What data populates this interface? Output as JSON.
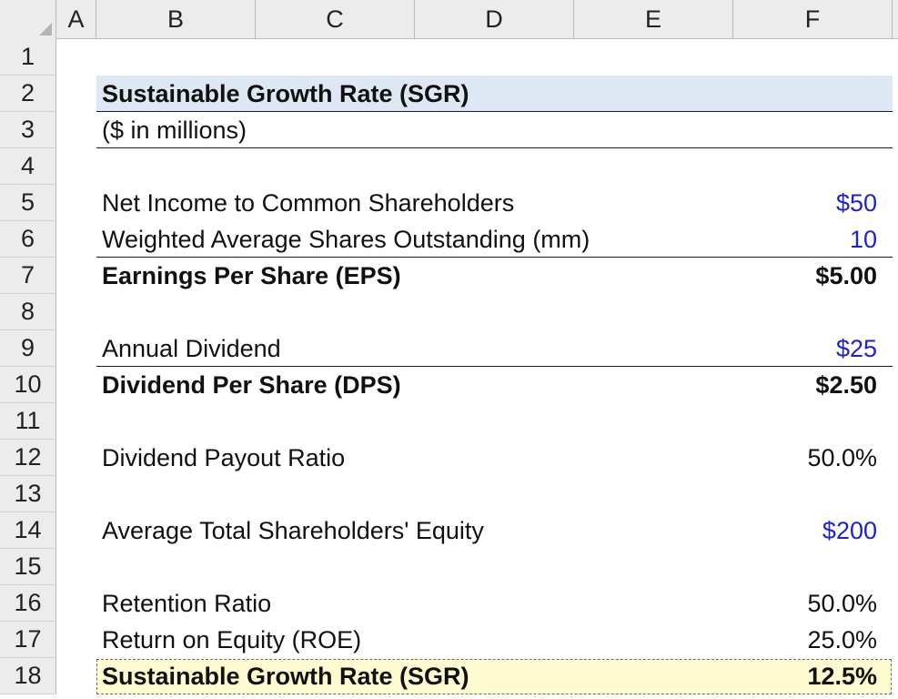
{
  "columns": [
    "A",
    "B",
    "C",
    "D",
    "E",
    "F"
  ],
  "rows": [
    "1",
    "2",
    "3",
    "4",
    "5",
    "6",
    "7",
    "8",
    "9",
    "10",
    "11",
    "12",
    "13",
    "14",
    "15",
    "16",
    "17",
    "18"
  ],
  "sheet": {
    "title": "Sustainable Growth Rate (SGR)",
    "subtitle": "($ in millions)",
    "net_income_label": "Net Income to Common Shareholders",
    "net_income_value": "$50",
    "shares_label": "Weighted Average Shares Outstanding (mm)",
    "shares_value": "10",
    "eps_label": "Earnings Per Share (EPS)",
    "eps_value": "$5.00",
    "annual_dividend_label": "Annual Dividend",
    "annual_dividend_value": "$25",
    "dps_label": "Dividend Per Share (DPS)",
    "dps_value": "$2.50",
    "payout_label": "Dividend Payout Ratio",
    "payout_value": "50.0%",
    "equity_label": "Average Total Shareholders' Equity",
    "equity_value": "$200",
    "retention_label": "Retention Ratio",
    "retention_value": "50.0%",
    "roe_label": "Return on Equity (ROE)",
    "roe_value": "25.0%",
    "sgr_label": "Sustainable Growth Rate (SGR)",
    "sgr_value": "12.5%"
  },
  "colors": {
    "input_blue": "#1f1fd6",
    "title_fill": "#dde8f4",
    "highlight_fill": "#fdfbcf",
    "header_fill": "#ececec"
  }
}
